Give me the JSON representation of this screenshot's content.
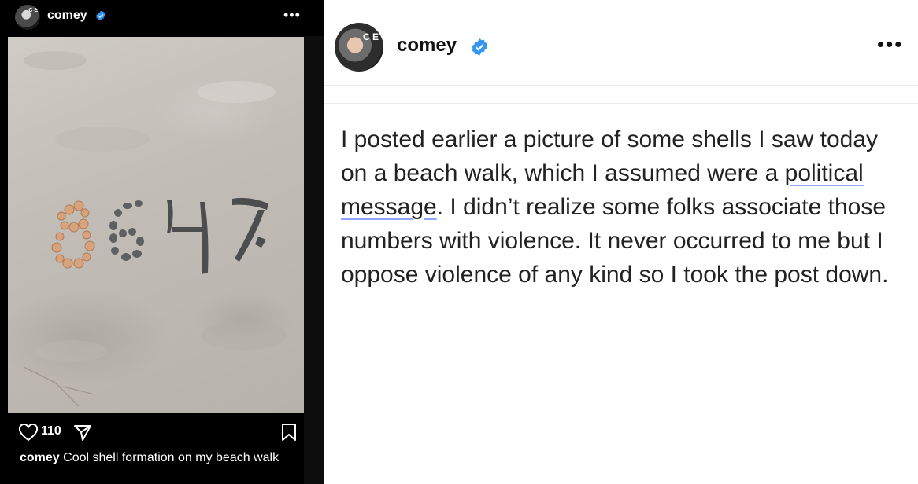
{
  "left_post": {
    "username": "comey",
    "avatar_text": "C E",
    "more": "•••",
    "likes": "110",
    "caption_user": "comey",
    "caption_text": "Cool shell formation on my beach walk"
  },
  "right_post": {
    "username": "comey",
    "avatar_text": "C E",
    "more": "•••",
    "text_before_1": "I posted earlier a picture of some shells I saw today on a beach walk, which I assumed were a ",
    "underlined_1": "political",
    "between": " ",
    "underlined_2": "message",
    "text_after": ". I didn’t realize some folks associate those numbers with violence. It never occurred to me but I oppose violence of any kind so I took the post down."
  },
  "colors": {
    "verified": "#3797f0",
    "dark_bg": "#000000",
    "light_bg": "#ffffff"
  },
  "icons": [
    "verified-badge-icon",
    "heart-icon",
    "share-icon",
    "bookmark-icon",
    "more-options-icon"
  ]
}
